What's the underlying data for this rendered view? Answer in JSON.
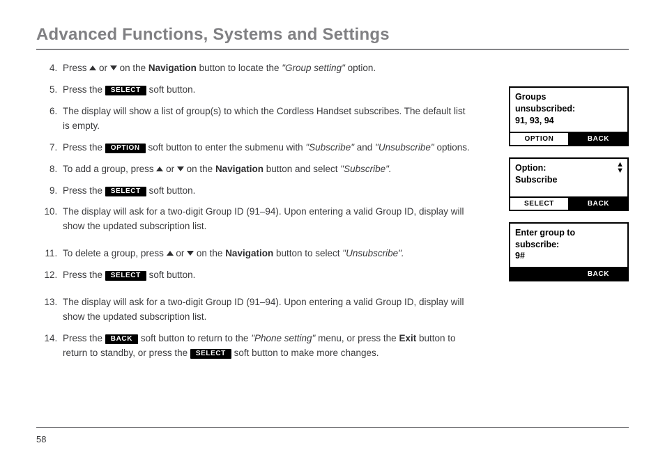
{
  "title": "Advanced Functions, Systems and Settings",
  "page_number": "58",
  "labels": {
    "select": "SELECT",
    "option": "OPTION",
    "back": "BACK",
    "navigation": "Navigation",
    "exit": "Exit"
  },
  "steps": {
    "s4a": "Press ",
    "s4b": " or ",
    "s4c": " on the ",
    "s4d": " button to locate the ",
    "s4e": "\"Group setting\"",
    "s4f": " option.",
    "s5a": "Press the ",
    "s5b": " soft button.",
    "s6": "The display will show a list of group(s) to which the Cordless Handset subscribes. The default list is empty.",
    "s7a": "Press the ",
    "s7b": " soft button to enter the submenu with ",
    "s7c": "\"Subscribe\"",
    "s7d": " and ",
    "s7e": "\"Unsubscribe\"",
    "s7f": " options.",
    "s8a": "To add a group, press ",
    "s8b": " or ",
    "s8c": " on the ",
    "s8d": " button and select ",
    "s8e": "\"Subscribe\".",
    "s9a": "Press the ",
    "s9b": " soft button.",
    "s10": "The display will ask for a two-digit Group ID (91–94). Upon entering a valid Group ID,  display will show the updated subscription list.",
    "s11a": "To delete a group, press ",
    "s11b": " or ",
    "s11c": " on the ",
    "s11d": " button to select ",
    "s11e": "\"Unsubscribe\".",
    "s12a": "Press the ",
    "s12b": " soft button.",
    "s13": "The display will ask for a two-digit Group ID (91–94). Upon entering a valid Group ID,  display will show the updated subscription list.",
    "s14a": "Press the ",
    "s14b": " soft button to return to the ",
    "s14c": "\"Phone setting\"",
    "s14d": " menu, or press the ",
    "s14e": " button to return to standby, or press the ",
    "s14f": " soft button to make more changes."
  },
  "screens": {
    "a": {
      "l1": "Groups",
      "l2": "unsubscribed:",
      "l3": "91, 93, 94",
      "left": "OPTION",
      "right": "BACK",
      "left_style": "light",
      "right_style": "dark",
      "arrows": false
    },
    "b": {
      "l1": "Option:",
      "l2": "Subscribe",
      "l3": "",
      "left": "SELECT",
      "right": "BACK",
      "left_style": "light",
      "right_style": "dark",
      "arrows": true
    },
    "c": {
      "l1": "Enter group to",
      "l2": "subscribe:",
      "l3": "9#",
      "left": "",
      "right": "BACK",
      "left_style": "dark",
      "right_style": "dark",
      "arrows": false
    }
  }
}
